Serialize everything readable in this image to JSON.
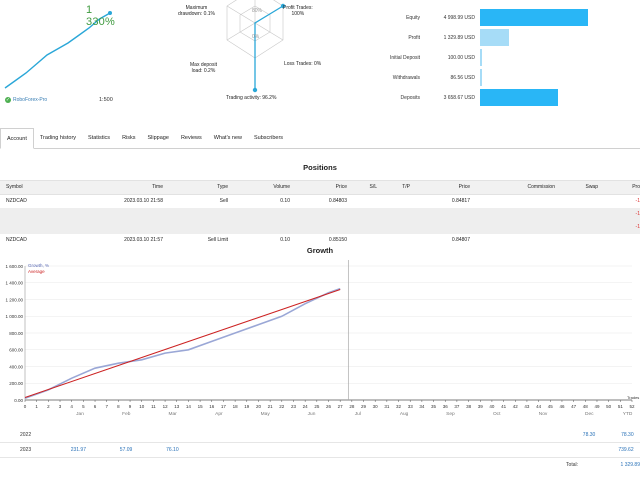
{
  "summary": {
    "growth_value": "1 330%",
    "broker": "RoboForex-Pro",
    "leverage": "1:500",
    "growth_spark": [
      0,
      10,
      20,
      32,
      44,
      52,
      60,
      70,
      80,
      92,
      100
    ]
  },
  "radar": {
    "labels": {
      "top_mark": "80%",
      "profit_trades": "Profit Trades:\n100%",
      "loss_trades": "Loss Trades: 0%",
      "trading_activity": "Trading activity: 96.2%",
      "max_deposit_load": "Max deposit\nload: 0.2%",
      "maximum_drawdown": "Maximum\ndrawdown: 0.1%",
      "center_mark": "0%"
    }
  },
  "bars": [
    {
      "label": "Equity",
      "value": "4 998.99 USD",
      "fraction": 0.94,
      "color": "#29b6f6"
    },
    {
      "label": "Profit",
      "value": "1 329.89 USD",
      "fraction": 0.25,
      "color": "#a6dcf7"
    },
    {
      "label": "Initial Deposit",
      "value": "100.00 USD",
      "fraction": 0.02,
      "color": "#a6dcf7"
    },
    {
      "label": "Withdrawals",
      "value": "86.56 USD",
      "fraction": 0.02,
      "color": "#a6dcf7"
    },
    {
      "label": "Deposits",
      "value": "3 658.67 USD",
      "fraction": 0.68,
      "color": "#29b6f6"
    }
  ],
  "tabs": [
    "Account",
    "Trading history",
    "Statistics",
    "Risks",
    "Slippage",
    "Reviews",
    "What's new",
    "Subscribers"
  ],
  "positions": {
    "title": "Positions",
    "headers": [
      "Symbol",
      "Time",
      "Type",
      "Volume",
      "Price",
      "S/L",
      "T/P",
      "Price",
      "Commission",
      "Swap",
      "Pro"
    ],
    "rows": [
      {
        "symbol": "NZDCAD",
        "time": "2023.03.10 21:58",
        "type": "Sell",
        "volume": "0.10",
        "price": "0.84803",
        "price2": "0.84817",
        "profit": "-1"
      },
      {
        "symbol": "NZDCAD",
        "time": "2023.03.10 21:57",
        "type": "Sell Limit",
        "volume": "0.10",
        "price": "0.85150",
        "price2": "0.84807",
        "profit": ""
      }
    ],
    "group_marks": [
      "-1",
      "-1"
    ]
  },
  "growth": {
    "title": "Growth",
    "legend_growth": "Growth, %",
    "legend_average": "Average",
    "x_tick_labels": [
      "0",
      "1",
      "2",
      "3",
      "4",
      "5",
      "6",
      "7",
      "8",
      "9",
      "10",
      "11",
      "12",
      "13",
      "14",
      "15",
      "16",
      "17",
      "18",
      "19",
      "20",
      "21",
      "22",
      "23",
      "24",
      "25",
      "26",
      "27",
      "28",
      "29",
      "30",
      "31",
      "32",
      "33",
      "34",
      "35",
      "36",
      "37",
      "38",
      "39",
      "40",
      "41",
      "42",
      "43",
      "44",
      "45",
      "46",
      "47",
      "48",
      "49",
      "50",
      "51",
      "52"
    ],
    "months": [
      "Jan",
      "Feb",
      "Mar",
      "Apr",
      "May",
      "Jun",
      "Jul",
      "Aug",
      "Sep",
      "Oct",
      "Nov",
      "Dec",
      "YTD"
    ],
    "trades_label": "Trades",
    "years": [
      {
        "year": "2022",
        "values": [
          "",
          "",
          "",
          "",
          "",
          "",
          "",
          "",
          "",
          "",
          "",
          "78.30",
          "78.30"
        ]
      },
      {
        "year": "2023",
        "values": [
          "231.97",
          "57.09",
          "76.10",
          "",
          "",
          "",
          "",
          "",
          "",
          "",
          "",
          "",
          "739.62"
        ]
      }
    ],
    "total_label": "Total:",
    "total_value": "1 329.89"
  },
  "chart_data": {
    "type": "line",
    "title": "Growth",
    "ylim": [
      0,
      1600
    ],
    "y_ticks": [
      "0.00",
      "200.00",
      "400.00",
      "600.00",
      "800.00",
      "1 000.00",
      "1 200.00",
      "1 400.00",
      "1 600.00"
    ],
    "series": [
      {
        "name": "Growth, %",
        "color": "#9aa7d6",
        "x": [
          0,
          2,
          4,
          6,
          8,
          10,
          12,
          14,
          16,
          18,
          20,
          22,
          24,
          26,
          27
        ],
        "y": [
          20,
          120,
          260,
          380,
          440,
          480,
          560,
          600,
          700,
          800,
          900,
          1000,
          1150,
          1280,
          1330
        ]
      },
      {
        "name": "Average",
        "color": "#cc2222",
        "x": [
          0,
          27
        ],
        "y": [
          30,
          1320
        ]
      }
    ],
    "marker_x": 27.7,
    "xlim": [
      0,
      52
    ]
  }
}
